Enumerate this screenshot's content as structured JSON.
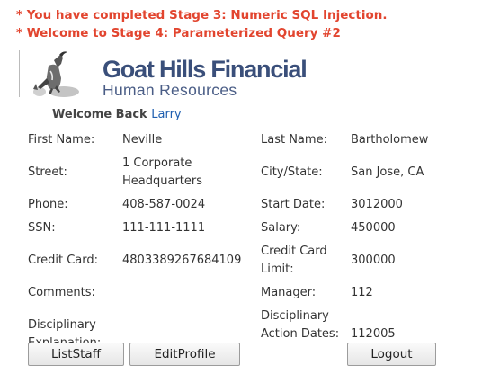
{
  "messages": [
    "* You have completed Stage 3: Numeric SQL Injection.",
    "* Welcome to Stage 4: Parameterized Query #2"
  ],
  "logo": {
    "title": "Goat Hills Financial",
    "subtitle": "Human Resources"
  },
  "welcome": {
    "prefix": "Welcome Back",
    "user": "Larry"
  },
  "profile": {
    "first_name_label": "First Name:",
    "first_name": "Neville",
    "last_name_label": "Last Name:",
    "last_name": "Bartholomew",
    "street_label": "Street:",
    "street": "1 Corporate Headquarters",
    "city_state_label": "City/State:",
    "city_state": "San Jose, CA",
    "phone_label": "Phone:",
    "phone": "408-587-0024",
    "start_date_label": "Start Date:",
    "start_date": "3012000",
    "ssn_label": "SSN:",
    "ssn": "111-111-1111",
    "salary_label": "Salary:",
    "salary": "450000",
    "credit_card_label": "Credit Card:",
    "credit_card": "4803389267684109",
    "credit_limit_label": "Credit Card Limit:",
    "credit_limit": "300000",
    "comments_label": "Comments:",
    "comments": "",
    "manager_label": "Manager:",
    "manager": "112",
    "disc_explanation_label": "Disciplinary Explanation:",
    "disc_explanation": "",
    "disc_dates_label": "Disciplinary Action Dates:",
    "disc_dates": "112005"
  },
  "buttons": {
    "list_staff": "ListStaff",
    "edit_profile": "EditProfile",
    "logout": "Logout"
  }
}
